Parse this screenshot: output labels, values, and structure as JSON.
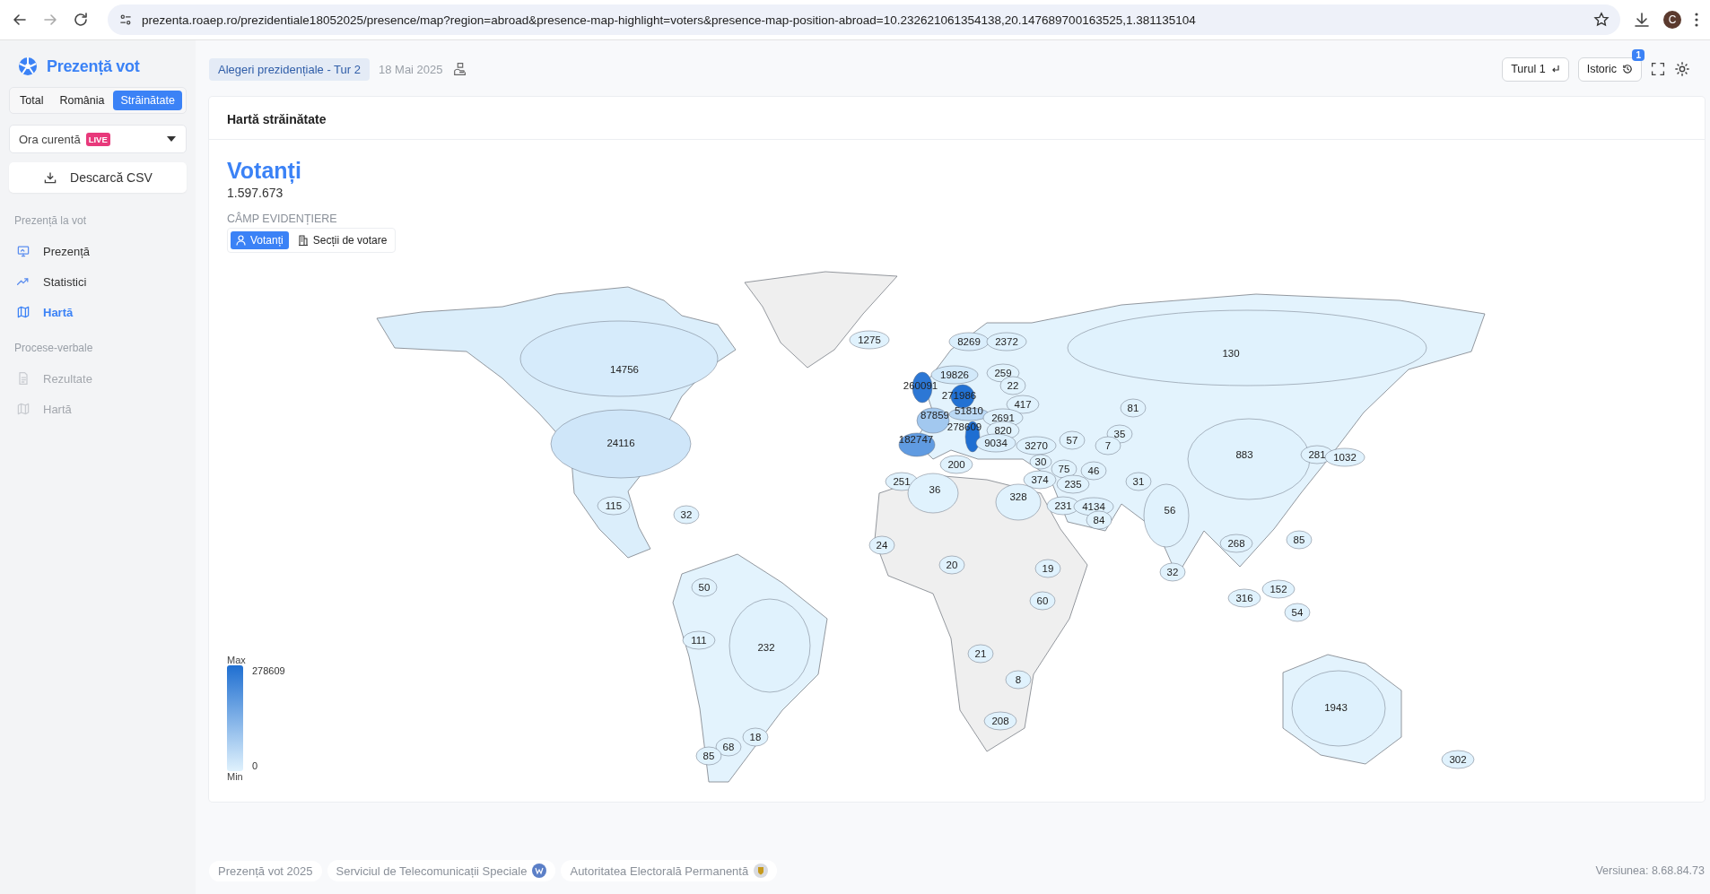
{
  "browser": {
    "url": "prezenta.roaep.ro/prezidentiale18052025/presence/map?region=abroad&presence-map-highlight=voters&presence-map-position-abroad=10.232621061354138,20.147689700163525,1.381135104",
    "avatar": "C"
  },
  "sidebar": {
    "logo": "Prezență vot",
    "scopes": [
      {
        "label": "Total",
        "selected": false
      },
      {
        "label": "România",
        "selected": false
      },
      {
        "label": "Străinătate",
        "selected": true
      }
    ],
    "time_select": {
      "value": "Ora curentă",
      "badge": "LIVE"
    },
    "download_button": "Descarcă CSV",
    "sections": [
      {
        "title": "Prezență la vot",
        "items": [
          {
            "label": "Prezență",
            "selected": false,
            "disabled": false
          },
          {
            "label": "Statistici",
            "selected": false,
            "disabled": false
          },
          {
            "label": "Hartă",
            "selected": true,
            "disabled": false
          }
        ]
      },
      {
        "title": "Procese-verbale",
        "items": [
          {
            "label": "Rezultate",
            "selected": false,
            "disabled": true
          },
          {
            "label": "Hartă",
            "selected": false,
            "disabled": true
          }
        ]
      }
    ]
  },
  "header": {
    "election": "Alegeri prezidențiale - Tur 2",
    "date": "18 Mai 2025",
    "round_button": "Turul 1",
    "history_button": "Istoric",
    "history_badge": "1"
  },
  "card": {
    "title": "Hartă străinătate",
    "metric": "Votanți",
    "total": "1.597.673",
    "highlight_label": "CÂMP EVIDENȚIERE",
    "highlight_options": [
      {
        "label": "Votanți",
        "selected": true
      },
      {
        "label": "Secții de votare",
        "selected": false
      }
    ],
    "legend": {
      "max_label": "Max",
      "max_value": "278609",
      "min_value": "0",
      "min_label": "Min"
    },
    "map_values": [
      {
        "value": "1275",
        "color": "#e0f2fd"
      },
      {
        "value": "8269",
        "color": "#daeefc"
      },
      {
        "value": "2372",
        "color": "#def1fd"
      },
      {
        "value": "14756",
        "color": "#d6ebfb"
      },
      {
        "value": "19826",
        "color": "#d2e9fa"
      },
      {
        "value": "259",
        "color": "#e0f2fd"
      },
      {
        "value": "130",
        "color": "#e0f2fd"
      },
      {
        "value": "260091",
        "color": "#2c77d5"
      },
      {
        "value": "22",
        "color": "#e0f2fd"
      },
      {
        "value": "271986",
        "color": "#2271d3"
      },
      {
        "value": "417",
        "color": "#e0f2fd"
      },
      {
        "value": "81",
        "color": "#e0f2fd"
      },
      {
        "value": "87859",
        "color": "#a2c8ef"
      },
      {
        "value": "51810",
        "color": "#bbd9f5"
      },
      {
        "value": "2691",
        "color": "#def1fd"
      },
      {
        "value": "35",
        "color": "#e0f2fd"
      },
      {
        "value": "278609",
        "color": "#1e6ed2"
      },
      {
        "value": "820",
        "color": "#e0f2fd"
      },
      {
        "value": "24116",
        "color": "#cfe6f9"
      },
      {
        "value": "182747",
        "color": "#609be1"
      },
      {
        "value": "9034",
        "color": "#daeefc"
      },
      {
        "value": "3270",
        "color": "#def1fd"
      },
      {
        "value": "57",
        "color": "#e0f2fd"
      },
      {
        "value": "7",
        "color": "#e0f2fd"
      },
      {
        "value": "883",
        "color": "#e0f2fd"
      },
      {
        "value": "281",
        "color": "#e0f2fd"
      },
      {
        "value": "1032",
        "color": "#e0f2fd"
      },
      {
        "value": "200",
        "color": "#e0f2fd"
      },
      {
        "value": "30",
        "color": "#e0f2fd"
      },
      {
        "value": "75",
        "color": "#e0f2fd"
      },
      {
        "value": "46",
        "color": "#e0f2fd"
      },
      {
        "value": "251",
        "color": "#e0f2fd"
      },
      {
        "value": "374",
        "color": "#e0f2fd"
      },
      {
        "value": "235",
        "color": "#e0f2fd"
      },
      {
        "value": "31",
        "color": "#e0f2fd"
      },
      {
        "value": "36",
        "color": "#e0f2fd"
      },
      {
        "value": "328",
        "color": "#e0f2fd"
      },
      {
        "value": "115",
        "color": "#e0f2fd"
      },
      {
        "value": "231",
        "color": "#e0f2fd"
      },
      {
        "value": "4134",
        "color": "#def1fd"
      },
      {
        "value": "56",
        "color": "#e0f2fd"
      },
      {
        "value": "84",
        "color": "#e0f2fd"
      },
      {
        "value": "32",
        "color": "#e0f2fd"
      },
      {
        "value": "85",
        "color": "#e0f2fd"
      },
      {
        "value": "24",
        "color": "#e0f2fd"
      },
      {
        "value": "268",
        "color": "#e0f2fd"
      },
      {
        "value": "20",
        "color": "#e0f2fd"
      },
      {
        "value": "19",
        "color": "#e0f2fd"
      },
      {
        "value": "32",
        "color": "#e0f2fd"
      },
      {
        "value": "50",
        "color": "#e0f2fd"
      },
      {
        "value": "152",
        "color": "#e0f2fd"
      },
      {
        "value": "60",
        "color": "#e0f2fd"
      },
      {
        "value": "316",
        "color": "#e0f2fd"
      },
      {
        "value": "54",
        "color": "#e0f2fd"
      },
      {
        "value": "111",
        "color": "#e0f2fd"
      },
      {
        "value": "232",
        "color": "#e0f2fd"
      },
      {
        "value": "21",
        "color": "#e0f2fd"
      },
      {
        "value": "8",
        "color": "#e0f2fd"
      },
      {
        "value": "1943",
        "color": "#def1fd"
      },
      {
        "value": "208",
        "color": "#e0f2fd"
      },
      {
        "value": "18",
        "color": "#e0f2fd"
      },
      {
        "value": "68",
        "color": "#e0f2fd"
      },
      {
        "value": "85",
        "color": "#e0f2fd"
      },
      {
        "value": "302",
        "color": "#e0f2fd"
      }
    ]
  },
  "footer": {
    "links": [
      "Prezență vot 2025",
      "Serviciul de Telecomunicații Speciale",
      "Autoritatea Electorală Permanentă"
    ],
    "version": "Versiunea: 8.68.84.73"
  }
}
